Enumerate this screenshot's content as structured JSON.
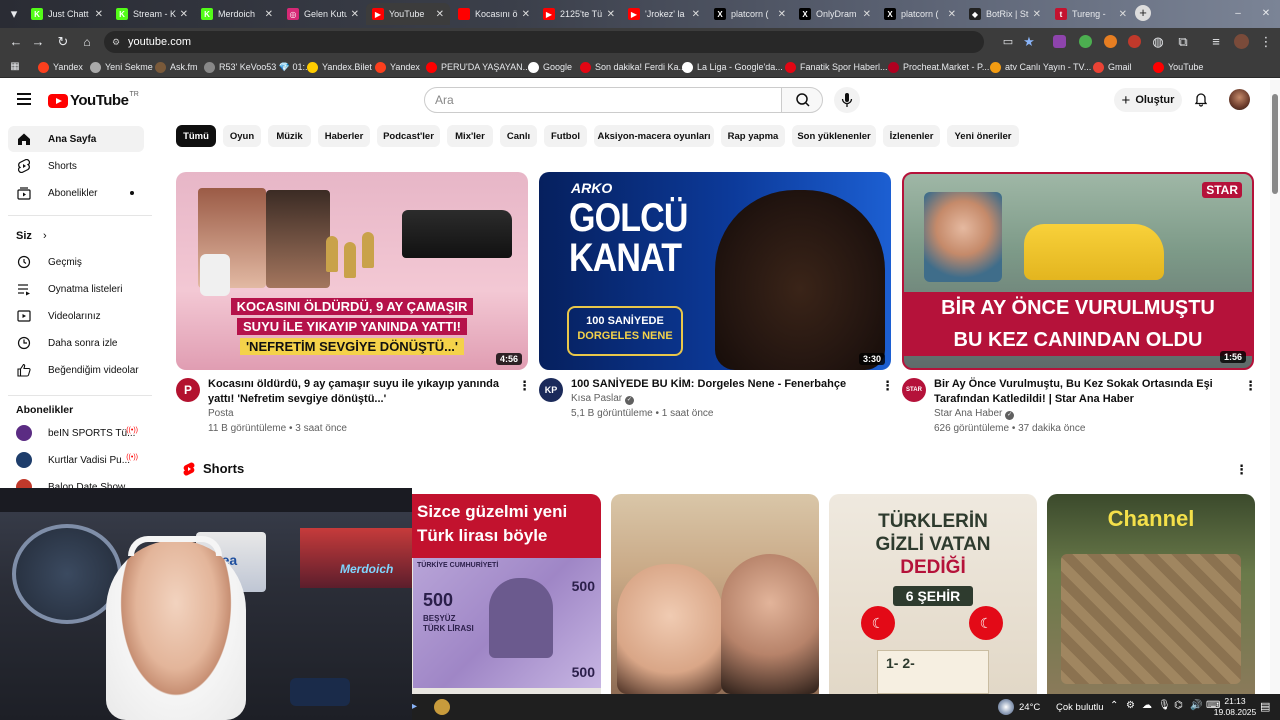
{
  "browser": {
    "tabs": [
      {
        "label": "Just Chatt",
        "color": "#53fc18",
        "glyph": "K"
      },
      {
        "label": "Stream - K",
        "color": "#53fc18",
        "glyph": "K"
      },
      {
        "label": "Merdoich",
        "color": "#53fc18",
        "glyph": "K"
      },
      {
        "label": "Gelen Kutu",
        "color": "#d62976",
        "glyph": "◎"
      },
      {
        "label": "YouTube",
        "color": "#ff0000",
        "glyph": "▶"
      },
      {
        "label": "Kocasını ö",
        "color": "#ff0000",
        "glyph": ""
      },
      {
        "label": "2125'te Tü",
        "color": "#ff0000",
        "glyph": "▶"
      },
      {
        "label": "'Jrokez' la",
        "color": "#ff0000",
        "glyph": "▶"
      },
      {
        "label": "platcorn (",
        "color": "#000000",
        "glyph": "X"
      },
      {
        "label": "OnlyDram",
        "color": "#000000",
        "glyph": "X"
      },
      {
        "label": "platcorn (",
        "color": "#000000",
        "glyph": "X"
      },
      {
        "label": "BotRix | St",
        "color": "#222222",
        "glyph": "◆"
      },
      {
        "label": "Tureng - ",
        "color": "#c4122f",
        "glyph": "t"
      }
    ],
    "url": "youtube.com",
    "bookmarks": [
      {
        "label": "Yandex",
        "color": "#fc3f1d"
      },
      {
        "label": "Yeni Sekme",
        "color": "#aaaaaa"
      },
      {
        "label": "Ask.fm",
        "color": "#7a5a3a"
      },
      {
        "label": "R53' KeVoo53 💎 01:...",
        "color": "#888888"
      },
      {
        "label": "Yandex.Bilet",
        "color": "#ffcc00"
      },
      {
        "label": "Yandex",
        "color": "#fc3f1d"
      },
      {
        "label": "PERU'DA YAŞAYAN...",
        "color": "#ff0000"
      },
      {
        "label": "Google",
        "color": "#ffffff"
      },
      {
        "label": "Son dakika! Ferdi Ka...",
        "color": "#e30613"
      },
      {
        "label": "La Liga - Google'da...",
        "color": "#ffffff"
      },
      {
        "label": "Fanatik Spor Haberl...",
        "color": "#e30613"
      },
      {
        "label": "Procheat.Market - P...",
        "color": "#b00020"
      },
      {
        "label": "atv Canlı Yayın - TV...",
        "color": "#f39c12"
      },
      {
        "label": "Gmail",
        "color": "#ea4335"
      },
      {
        "label": "YouTube",
        "color": "#ff0000"
      }
    ]
  },
  "header": {
    "logo_text": "YouTube",
    "logo_tr": "TR",
    "search_placeholder": "Ara",
    "create_label": "Oluştur"
  },
  "sidebar": {
    "main": [
      {
        "label": "Ana Sayfa",
        "icon": "home-icon"
      },
      {
        "label": "Shorts",
        "icon": "shorts-icon"
      },
      {
        "label": "Abonelikler",
        "icon": "subscriptions-icon"
      }
    ],
    "you_title": "Siz",
    "you": [
      {
        "label": "Geçmiş",
        "icon": "history-icon"
      },
      {
        "label": "Oynatma listeleri",
        "icon": "playlists-icon"
      },
      {
        "label": "Videolarınız",
        "icon": "your-videos-icon"
      },
      {
        "label": "Daha sonra izle",
        "icon": "watch-later-icon"
      },
      {
        "label": "Beğendiğim videolar",
        "icon": "liked-videos-icon"
      }
    ],
    "subs_title": "Abonelikler",
    "subs": [
      {
        "label": "beIN SPORTS Tü...",
        "color": "#5b2c83"
      },
      {
        "label": "Kurtlar Vadisi Pu...",
        "color": "#1e3d6b"
      },
      {
        "label": "Balon Date Show",
        "color": "#c0392b"
      }
    ]
  },
  "chips": [
    "Tümü",
    "Oyun",
    "Müzik",
    "Haberler",
    "Podcast'ler",
    "Mix'ler",
    "Canlı",
    "Futbol",
    "Aksiyon-macera oyunları",
    "Rap yapma",
    "Son yüklenenler",
    "İzlenenler",
    "Yeni öneriler"
  ],
  "videos": [
    {
      "title": "Kocasını öldürdü, 9 ay çamaşır suyu ile yıkayıp yanında yattı! 'Nefretim sevgiye dönüştü...'",
      "channel": "Posta",
      "views": "11 B görüntüleme",
      "age": "3 saat önce",
      "duration": "4:56",
      "avatar_text": "P",
      "thumb_line1": "KOCASINI ÖLDÜRDÜ, 9 AY ÇAMAŞIR",
      "thumb_line2": "SUYU İLE YIKAYIP YANINDA YATTI!",
      "thumb_line3": "'NEFRETİM SEVGİYE DÖNÜŞTÜ...'"
    },
    {
      "title": "100 SANİYEDE BU KİM: Dorgeles Nene - Fenerbahçe",
      "channel": "Kısa Paslar",
      "views": "5,1 B görüntüleme",
      "age": "1 saat önce",
      "duration": "3:30",
      "avatar_text": "KP",
      "thumb_brand": "ARKO",
      "thumb_line1": "GOLCÜ",
      "thumb_line2": "KANAT",
      "thumb_line3": "100 SANİYEDE",
      "thumb_line4": "DORGELES NENE"
    },
    {
      "title": "Bir Ay Önce Vurulmuştu, Bu Kez Sokak Ortasında Eşi Tarafından Katledildi! | Star Ana Haber",
      "channel": "Star Ana Haber",
      "views": "626 görüntüleme",
      "age": "37 dakika önce",
      "duration": "1:56",
      "avatar_text": "STAR",
      "thumb_brand": "STAR",
      "thumb_line1": "BİR AY ÖNCE VURULMUŞTU",
      "thumb_line2": "BU KEZ CANINDAN OLDU"
    }
  ],
  "shorts": {
    "title": "Shorts",
    "items": [
      {
        "line1": "Sizce güzelmi yeni",
        "line2": "Türk lirası böyle",
        "note_top": "TÜRKİYE CUMHURİYETİ",
        "note_val": "500",
        "note_words": "BEŞYÜZ TÜRK LİRASI"
      },
      {
        "line1": "",
        "line2": ""
      },
      {
        "line1": "TÜRKLERİN",
        "line2": "GİZLİ VATAN",
        "line3": "DEDİĞİ",
        "line4": "6 ŞEHİR",
        "list": "1- 2-"
      },
      {
        "line1": "Channel"
      }
    ]
  },
  "webcam": {
    "overlay": "Merdoich",
    "jersey": "avea"
  },
  "taskbar": {
    "temp": "24°C",
    "weather": "Çok bulutlu",
    "time": "21:13",
    "date": "19.08.2025"
  }
}
